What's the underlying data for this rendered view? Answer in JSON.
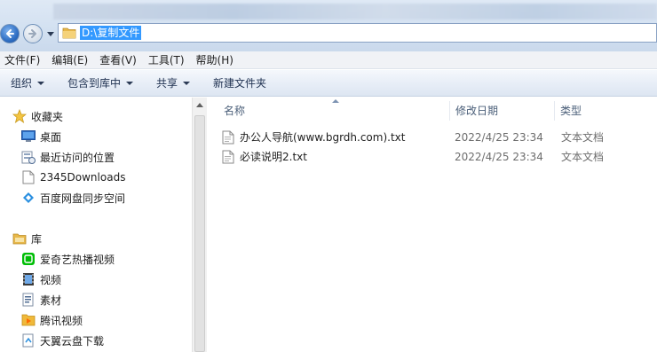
{
  "address": {
    "path": "D:\\复制文件"
  },
  "menu": [
    "文件(F)",
    "编辑(E)",
    "查看(V)",
    "工具(T)",
    "帮助(H)"
  ],
  "commands": [
    {
      "label": "组织",
      "dropdown": true
    },
    {
      "label": "包含到库中",
      "dropdown": true
    },
    {
      "label": "共享",
      "dropdown": true
    },
    {
      "label": "新建文件夹",
      "dropdown": false
    }
  ],
  "nav": {
    "favorites_title": "收藏夹",
    "favorites": [
      {
        "label": "桌面",
        "icon": "desktop-icon"
      },
      {
        "label": "最近访问的位置",
        "icon": "recent-places-icon"
      },
      {
        "label": "2345Downloads",
        "icon": "folder-icon"
      },
      {
        "label": "百度网盘同步空间",
        "icon": "baidu-netdisk-icon"
      }
    ],
    "libraries_title": "库",
    "libraries": [
      {
        "label": "爱奇艺热播视频",
        "icon": "iqiyi-icon"
      },
      {
        "label": "视频",
        "icon": "video-library-icon"
      },
      {
        "label": "素材",
        "icon": "document-library-icon"
      },
      {
        "label": "腾讯视频",
        "icon": "tencent-video-icon"
      },
      {
        "label": "天翼云盘下载",
        "icon": "tianyi-cloud-icon"
      }
    ]
  },
  "columns": {
    "name": "名称",
    "modified": "修改日期",
    "type": "类型"
  },
  "files": [
    {
      "name": "办公人导航(www.bgrdh.com).txt",
      "modified": "2022/4/25 23:34",
      "type": "文本文档"
    },
    {
      "name": "必读说明2.txt",
      "modified": "2022/4/25 23:34",
      "type": "文本文档"
    }
  ],
  "colors": {
    "selection": "#3399ff",
    "header_text": "#4c607a",
    "muted_text": "#6d6d6d"
  }
}
